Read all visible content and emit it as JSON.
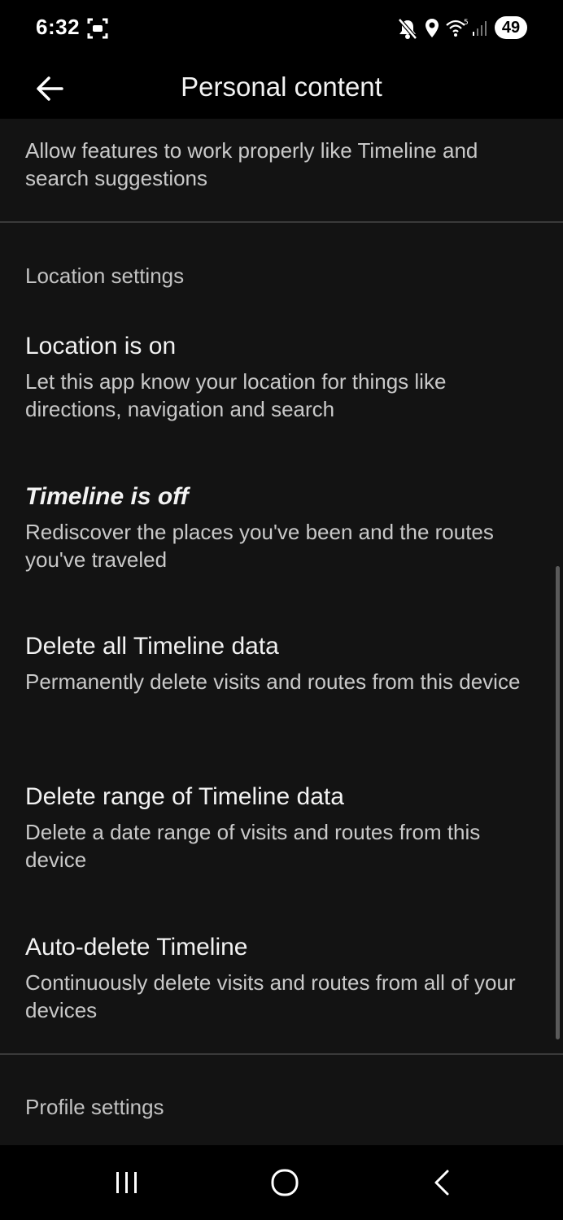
{
  "status_bar": {
    "time": "6:32",
    "battery": "49",
    "icons": [
      "screenshot-icon",
      "mute-icon",
      "location-icon",
      "wifi-icon",
      "signal-icon",
      "battery-icon"
    ]
  },
  "app_bar": {
    "title": "Personal content",
    "back_icon": "arrow-back-icon"
  },
  "intro_text": "Allow features to work properly like Timeline and search suggestions",
  "location_section": {
    "header": "Location settings",
    "items": [
      {
        "title": "Location is on",
        "subtitle": "Let this app know your location for things like directions, navigation and search"
      },
      {
        "title": "Timeline is off",
        "subtitle": "Rediscover the places you've been and the routes you've traveled"
      },
      {
        "title": "Delete all Timeline data",
        "subtitle": "Permanently delete visits and routes from this device"
      },
      {
        "title": "Delete range of Timeline data",
        "subtitle": "Delete a date range of visits and routes from this device"
      },
      {
        "title": "Auto-delete Timeline",
        "subtitle": "Continuously delete visits and routes from all of your devices"
      }
    ]
  },
  "profile_section": {
    "header": "Profile settings"
  },
  "nav_bar": {
    "icons": [
      "recent-apps-icon",
      "home-icon",
      "back-icon"
    ]
  },
  "colors": {
    "background": "#131313",
    "bars": "#000000",
    "primary_text": "#f2f2f2",
    "secondary_text": "#c9c9c9",
    "divider": "#3a3a3a"
  }
}
